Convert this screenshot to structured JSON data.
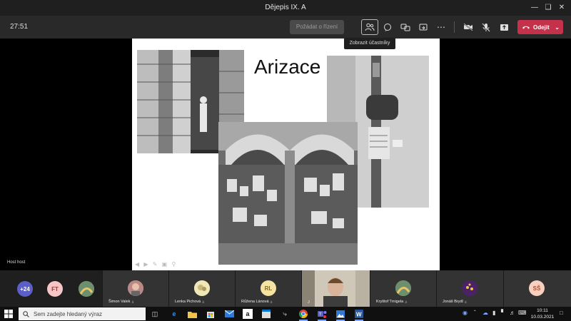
{
  "window": {
    "title": "Dějepis IX. A"
  },
  "toolbar": {
    "timer": "27:51",
    "raise_hand": "Požádat o řízení",
    "leave": "Odejít",
    "tooltip": "Zobrazit účastníky"
  },
  "slide": {
    "title": "Arizace"
  },
  "stage": {
    "presenter": "Host host"
  },
  "participants": {
    "more_count": "+24",
    "tiles": [
      {
        "initials": "FT",
        "color": "#f6c6c6"
      },
      {
        "name": "Šimon Valek"
      },
      {
        "name": "Lenka Pichová"
      },
      {
        "name": "Růžena Lánová",
        "initials": "RL",
        "color": "#f5e3a3"
      },
      {
        "name": "J"
      },
      {
        "name": "Kryštof Trnigela"
      },
      {
        "name": "Jonáš Brydl"
      },
      {
        "initials": "SŠ",
        "color": "#f7d0c0"
      }
    ]
  },
  "taskbar": {
    "search_placeholder": "Sem zadejte hledaný výraz",
    "time": "10:11",
    "date": "10.03.2021"
  },
  "colors": {
    "leave": "#c4314b",
    "toolbar": "#292929",
    "titlebar": "#1f1f1f"
  }
}
